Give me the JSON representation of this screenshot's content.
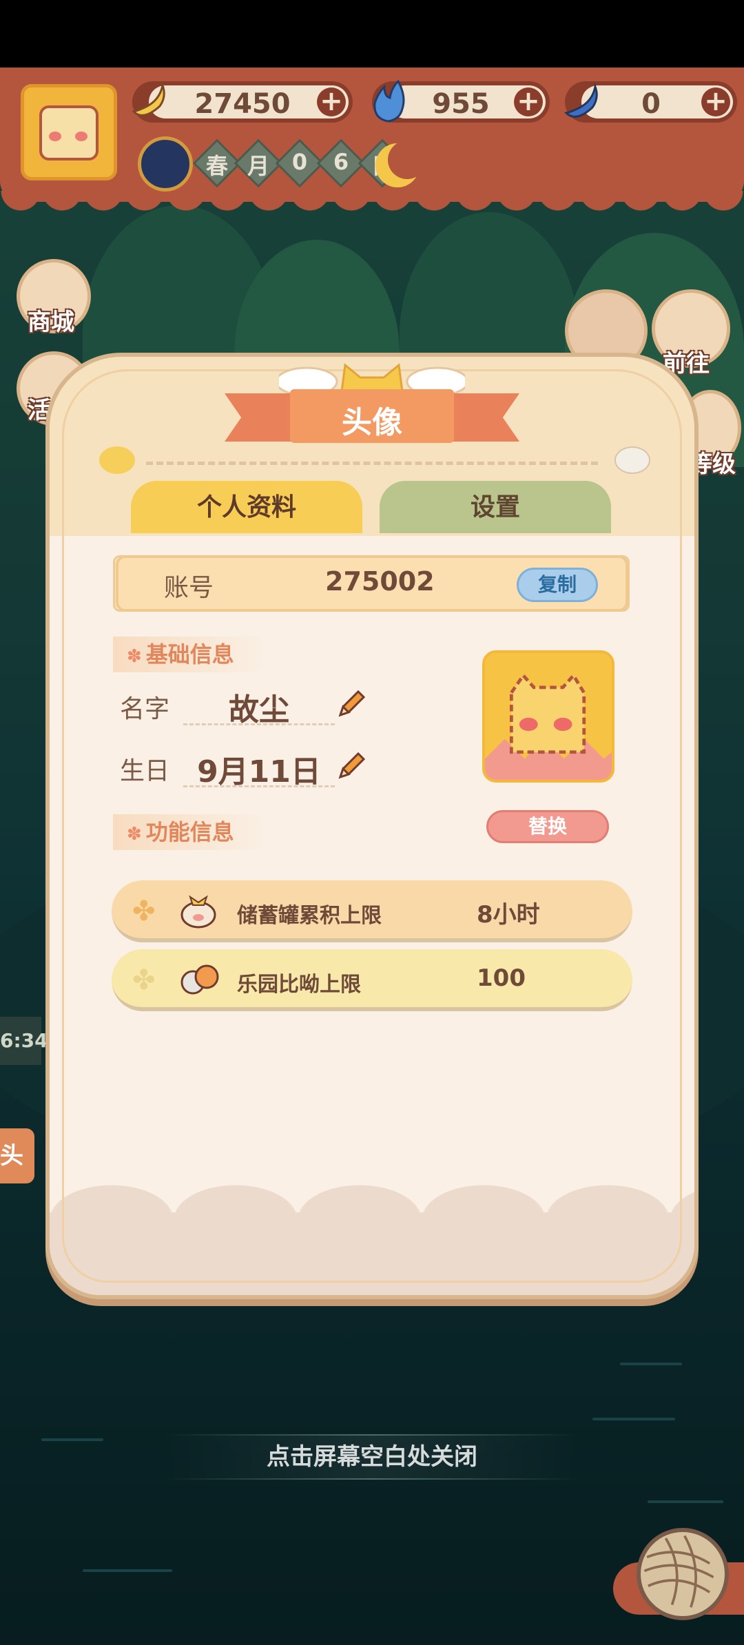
{
  "resources": [
    {
      "name": "banana",
      "value": "27450",
      "icon": "banana-icon"
    },
    {
      "name": "flame",
      "value": "955",
      "icon": "blue-flame-icon"
    },
    {
      "name": "blue_banana",
      "value": "0",
      "icon": "blue-banana-icon"
    }
  ],
  "date": {
    "chars": [
      "春",
      "月",
      "0",
      "6",
      "日"
    ]
  },
  "side_menu": {
    "shop": "商城",
    "activity_partial": "活",
    "goto": "前往",
    "level_partial": "等级"
  },
  "dialog": {
    "title": "头像",
    "tabs": {
      "profile": "个人资料",
      "settings": "设置"
    },
    "account": {
      "label": "账号",
      "value": "275002",
      "copy": "复制"
    },
    "basic_section": "基础信息",
    "name": {
      "label": "名字",
      "value": "故尘"
    },
    "birthday": {
      "label": "生日",
      "value": "9月11日"
    },
    "replace": "替换",
    "func_section": "功能信息",
    "functions": [
      {
        "name": "储蓄罐累积上限",
        "value": "8小时"
      },
      {
        "name": "乐园比呦上限",
        "value": "100"
      }
    ]
  },
  "background_fragments": {
    "time": "6:34",
    "tag": "头"
  },
  "close_hint": "点击屏幕空白处关闭",
  "colors": {
    "header": "#b4563e",
    "dialog_border": "#d8b68d",
    "ribbon": "#f39a62",
    "tab_active": "#f8cd55",
    "tab_inactive": "#b9c58d",
    "copy_button": "#a9cdea",
    "replace_button": "#f29a8f"
  }
}
